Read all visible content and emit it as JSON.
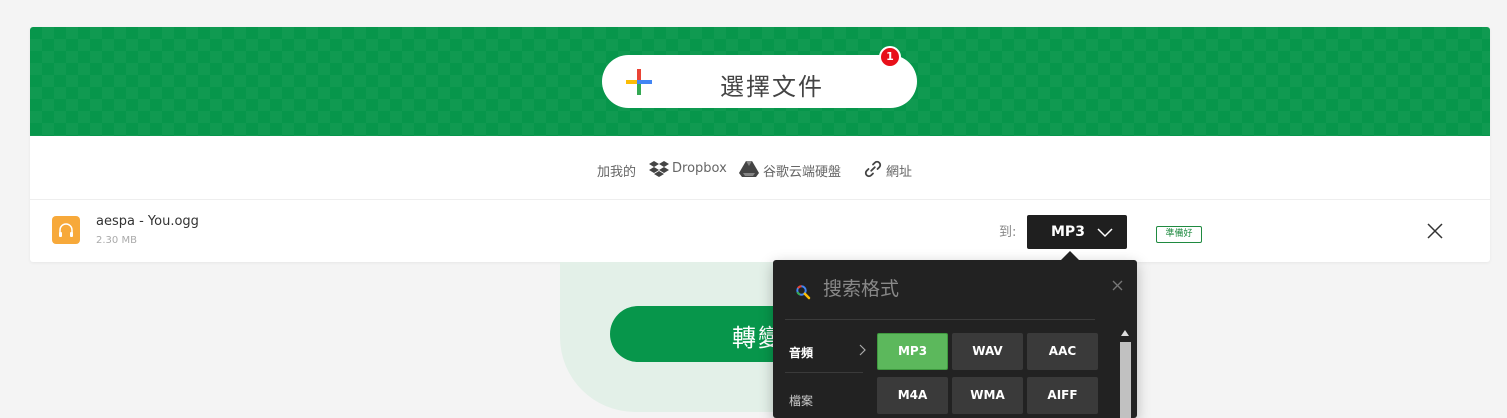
{
  "upload": {
    "choose_label": "選擇文件",
    "file_count_badge": "1"
  },
  "sources": {
    "prefix": "加我的",
    "dropbox": "Dropbox",
    "google_drive": "谷歌云端硬盤",
    "url": "網址"
  },
  "file": {
    "name": "aespa - You.ogg",
    "size": "2.30 MB",
    "to_label": "到:",
    "format": "MP3",
    "status": "準備好",
    "icon": "headphones-icon"
  },
  "convert": {
    "label": "轉變"
  },
  "format_dropdown": {
    "search_placeholder": "搜索格式",
    "categories": [
      {
        "label": "音頻",
        "selected": true
      },
      {
        "label": "檔案",
        "selected": false
      }
    ],
    "formats": [
      {
        "label": "MP3",
        "selected": true
      },
      {
        "label": "WAV",
        "selected": false
      },
      {
        "label": "AAC",
        "selected": false
      },
      {
        "label": "M4A",
        "selected": false
      },
      {
        "label": "WMA",
        "selected": false
      },
      {
        "label": "AIFF",
        "selected": false
      }
    ]
  },
  "colors": {
    "brand_green": "#07964b",
    "badge_red": "#e8101a",
    "active_format": "#5cb85c",
    "dropdown_bg": "#222222",
    "file_icon_orange": "#f7a93a"
  }
}
